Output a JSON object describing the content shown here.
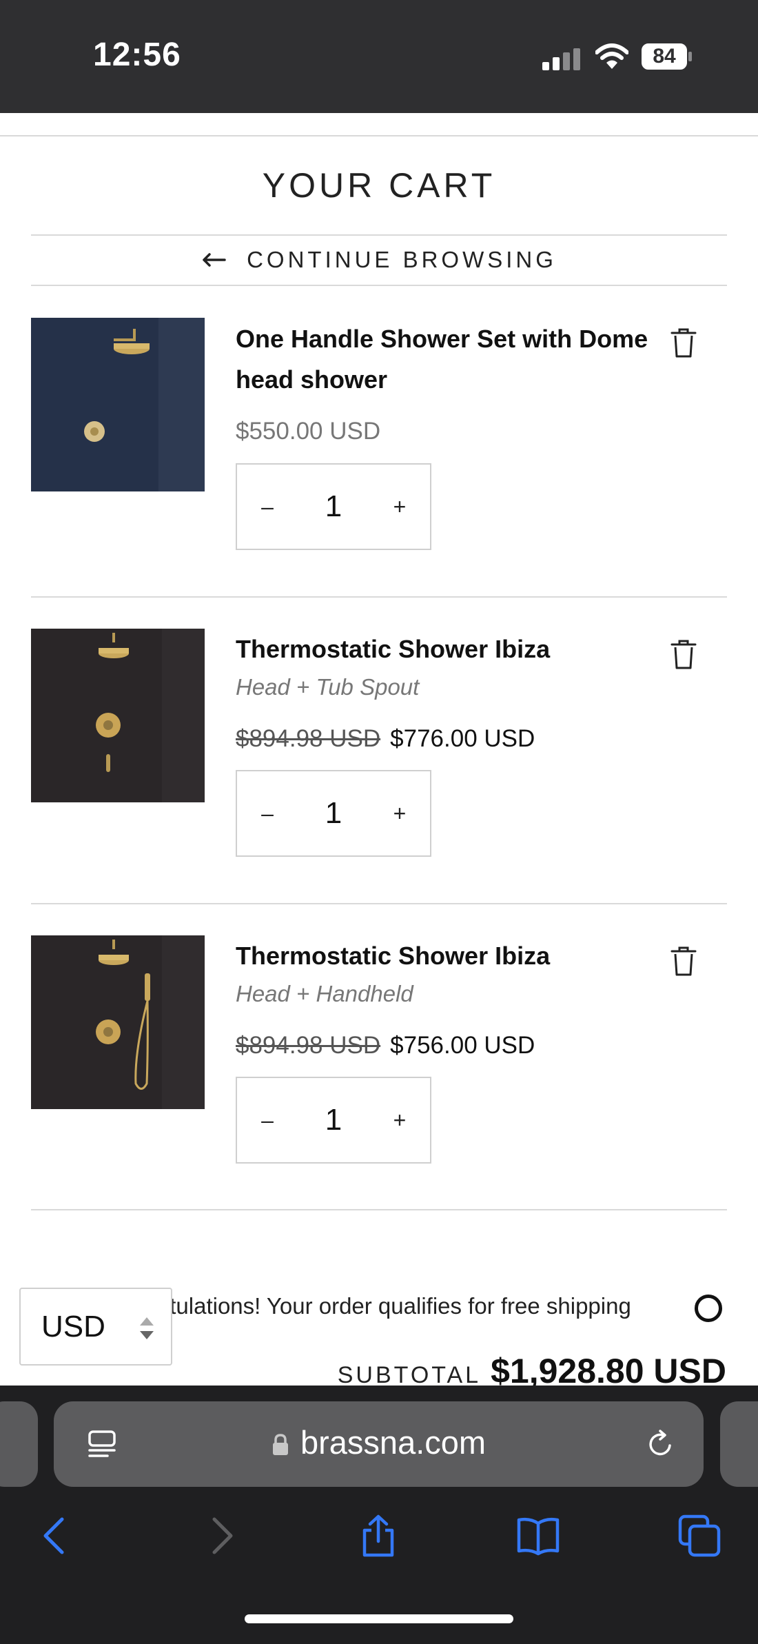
{
  "status_bar": {
    "time": "12:56",
    "battery": "84"
  },
  "page": {
    "title": "YOUR CART",
    "continue_label": "CONTINUE BROWSING"
  },
  "items": [
    {
      "title": "One Handle Shower Set with Dome head shower",
      "price": "$550.00 USD",
      "quantity": "1"
    },
    {
      "title": "Thermostatic Shower Ibiza",
      "variant": "Head + Tub Spout",
      "old_price": "$894.98 USD",
      "price": "$776.00 USD",
      "quantity": "1"
    },
    {
      "title": "Thermostatic Shower Ibiza",
      "variant": "Head + Handheld",
      "old_price": "$894.98 USD",
      "price": "$756.00 USD",
      "quantity": "1"
    }
  ],
  "qty_controls": {
    "minus": "–",
    "plus": "+"
  },
  "shipping_message": "Congratulations! Your order qualifies for free shipping",
  "currency": {
    "selected": "USD"
  },
  "subtotal": {
    "label": "SUBTOTAL",
    "value": "$1,928.80 USD"
  },
  "browser": {
    "url": "brassna.com"
  },
  "colors": {
    "status_bar": "#2f2f31",
    "browser_chrome": "#1f1f21",
    "ios_blue": "#3478f6"
  },
  "icons": [
    "arrow-left-icon",
    "trash-icon",
    "reader-icon",
    "lock-icon",
    "reload-icon",
    "back-icon",
    "forward-icon",
    "share-icon",
    "bookmarks-icon",
    "tabs-icon",
    "signal-icon",
    "wifi-icon",
    "battery-icon"
  ]
}
